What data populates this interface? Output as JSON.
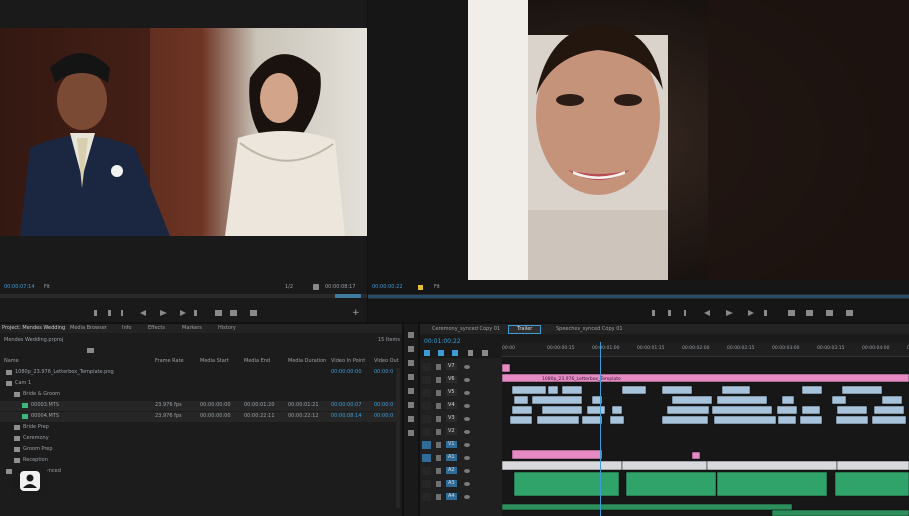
{
  "source_monitor": {
    "timecode_in": "00:00:07:14",
    "fit_label": "Fit",
    "timecode_out": "00:00:08:17",
    "ratio_label": "1/2"
  },
  "program_monitor": {
    "timecode": "00:00:00:22",
    "fit_label": "Fit",
    "tab_label": "Full"
  },
  "project_panel": {
    "tabs": [
      "Project: Mendes Wedding",
      "Media Browser",
      "Info",
      "Effects",
      "Markers",
      "History"
    ],
    "project_file": "Mendes Wedding.prproj",
    "item_count": "15 Items",
    "columns": [
      "Name",
      "Frame Rate",
      "Media Start",
      "Media End",
      "Media Duration",
      "Video In Point",
      "Video Out"
    ],
    "rows": [
      {
        "name": "1080p_23.976_Letterbox_Template.png",
        "indent": 0,
        "kind": "file",
        "frame_rate": "",
        "media_start": "",
        "media_end": "",
        "media_duration": "",
        "video_in": "00:00:00:00",
        "video_out": "00:00:0"
      },
      {
        "name": "Cam 1",
        "indent": 0,
        "kind": "bin",
        "frame_rate": "",
        "media_start": "",
        "media_end": "",
        "media_duration": "",
        "video_in": "",
        "video_out": ""
      },
      {
        "name": "Bride & Groom",
        "indent": 1,
        "kind": "bin",
        "frame_rate": "",
        "media_start": "",
        "media_end": "",
        "media_duration": "",
        "video_in": "",
        "video_out": ""
      },
      {
        "name": "00003.MTS",
        "indent": 2,
        "kind": "clip",
        "frame_rate": "23.976 fps",
        "media_start": "00:00:00:00",
        "media_end": "00:00:01:20",
        "media_duration": "00:00:01:21",
        "video_in": "00:00:00:07",
        "video_out": "00:00:0"
      },
      {
        "name": "00004.MTS",
        "indent": 2,
        "kind": "clip",
        "frame_rate": "23.976 fps",
        "media_start": "00:00:00:00",
        "media_end": "00:00:22:11",
        "media_duration": "00:00:22:12",
        "video_in": "00:00:08:14",
        "video_out": "00:00:0"
      },
      {
        "name": "Bride Prep",
        "indent": 1,
        "kind": "bin",
        "frame_rate": "",
        "media_start": "",
        "media_end": "",
        "media_duration": "",
        "video_in": "",
        "video_out": ""
      },
      {
        "name": "Ceremony",
        "indent": 1,
        "kind": "bin",
        "frame_rate": "",
        "media_start": "",
        "media_end": "",
        "media_duration": "",
        "video_in": "",
        "video_out": ""
      },
      {
        "name": "Groom Prep",
        "indent": 1,
        "kind": "bin",
        "frame_rate": "",
        "media_start": "",
        "media_end": "",
        "media_duration": "",
        "video_in": "",
        "video_out": ""
      },
      {
        "name": "Reception",
        "indent": 1,
        "kind": "bin",
        "frame_rate": "",
        "media_start": "",
        "media_end": "",
        "media_duration": "",
        "video_in": "",
        "video_out": ""
      },
      {
        "name": "Ceremony_synced",
        "indent": 0,
        "kind": "bin",
        "frame_rate": "",
        "media_start": "",
        "media_end": "",
        "media_duration": "",
        "video_in": "",
        "video_out": ""
      }
    ]
  },
  "timeline": {
    "tabs": [
      "Ceremony_synced Copy 01",
      "Trailer",
      "Speeches_synced Copy 01"
    ],
    "active_tab": 1,
    "timecode": "00:01:00:22",
    "ruler_ticks": [
      "00:00",
      "00:00:00:15",
      "00:00:01:00",
      "00:00:01:15",
      "00:00:02:00",
      "00:00:02:15",
      "00:00:03:00",
      "00:00:03:15",
      "00:00:04:00",
      "00:00:04:15"
    ],
    "track_labels": [
      "V7",
      "V6",
      "V5",
      "V4",
      "V3",
      "V2",
      "V1",
      "A1",
      "A2",
      "A3",
      "A4"
    ],
    "pink_clip_label": "1080p_23.976_Letterbox_Template"
  },
  "colors": {
    "accent": "#3f9bd6",
    "pink_clip": "#e58ac3",
    "blue_clip": "#a7c3dc",
    "green_clip": "#2fa36a",
    "panel_bg": "#1e1e1e"
  },
  "icons": [
    "play-icon",
    "step-back-icon",
    "step-forward-icon",
    "mark-in-icon",
    "mark-out-icon",
    "insert-icon",
    "overwrite-icon",
    "export-frame-icon",
    "add-icon",
    "wrench-icon",
    "folder-icon",
    "lock-icon",
    "eye-icon",
    "user-icon"
  ]
}
